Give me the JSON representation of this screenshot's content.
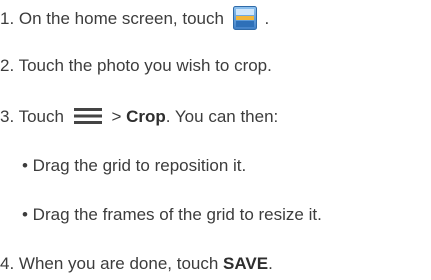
{
  "steps": {
    "s1": {
      "pre": "1. On the home screen, touch",
      "post": "."
    },
    "s2": {
      "text": "2. Touch the photo you wish to crop."
    },
    "s3": {
      "pre": "3. Touch",
      "gt": "> ",
      "bold": "Crop",
      "post": ". You can then:"
    },
    "bullet1": {
      "text": "• Drag the grid to reposition it."
    },
    "bullet2": {
      "text": "• Drag the frames of the grid to resize it."
    },
    "s4": {
      "pre": "4. When you are done, touch ",
      "bold": "SAVE",
      "post": "."
    }
  },
  "icons": {
    "gallery": "gallery-app-icon",
    "menu": "menu-icon"
  },
  "colors": {
    "text": "#3c3c3c",
    "gallery_icon_bg": "#4a8fd4",
    "gallery_icon_accent": "#f0b33c"
  }
}
